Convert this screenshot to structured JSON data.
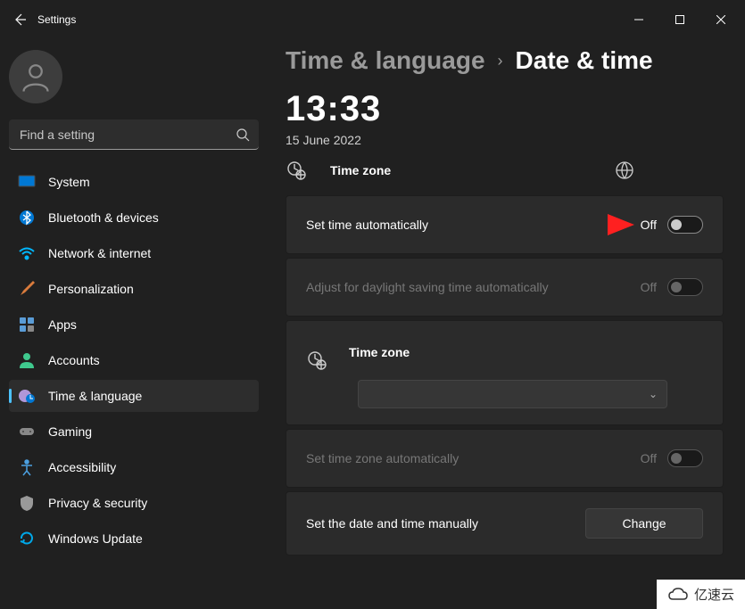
{
  "titlebar": {
    "title": "Settings"
  },
  "search": {
    "placeholder": "Find a setting"
  },
  "sidebar": {
    "items": [
      {
        "label": "System"
      },
      {
        "label": "Bluetooth & devices"
      },
      {
        "label": "Network & internet"
      },
      {
        "label": "Personalization"
      },
      {
        "label": "Apps"
      },
      {
        "label": "Accounts"
      },
      {
        "label": "Time & language"
      },
      {
        "label": "Gaming"
      },
      {
        "label": "Accessibility"
      },
      {
        "label": "Privacy & security"
      },
      {
        "label": "Windows Update"
      }
    ]
  },
  "breadcrumb": {
    "parent": "Time & language",
    "current": "Date & time"
  },
  "clock": {
    "time": "13:33",
    "date": "15 June 2022"
  },
  "tzheader": {
    "label": "Time zone"
  },
  "settings": {
    "autoTime": {
      "label": "Set time automatically",
      "state": "Off"
    },
    "dst": {
      "label": "Adjust for daylight saving time automatically",
      "state": "Off"
    },
    "tz": {
      "label": "Time zone",
      "value": ""
    },
    "autoTz": {
      "label": "Set time zone automatically",
      "state": "Off"
    },
    "manual": {
      "label": "Set the date and time manually",
      "button": "Change"
    }
  },
  "watermark": {
    "text": "亿速云"
  }
}
